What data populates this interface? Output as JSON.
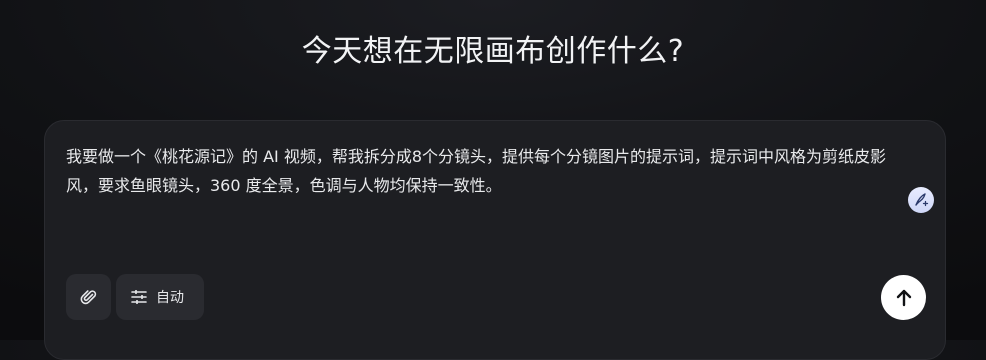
{
  "page": {
    "title": "今天想在无限画布创作什么?"
  },
  "composer": {
    "prompt_text": "我要做一个《桃花源记》的 AI 视频，帮我拆分成8个分镜头，提供每个分镜图片的提示词，提示词中风格为剪纸皮影风，要求鱼眼镜头，360 度全景，色调与人物均保持一致性。",
    "toolbar": {
      "attach_icon": "paperclip-icon",
      "mode_icon": "sliders-icon",
      "mode_label": "自动",
      "optimize_icon": "quill-sparkle-icon",
      "send_icon": "arrow-up-icon"
    }
  },
  "colors": {
    "background": "#111215",
    "composer_bg": "#1d1e22",
    "button_bg": "#2a2b30",
    "send_bg": "#ffffff",
    "text": "#e9eaec"
  }
}
